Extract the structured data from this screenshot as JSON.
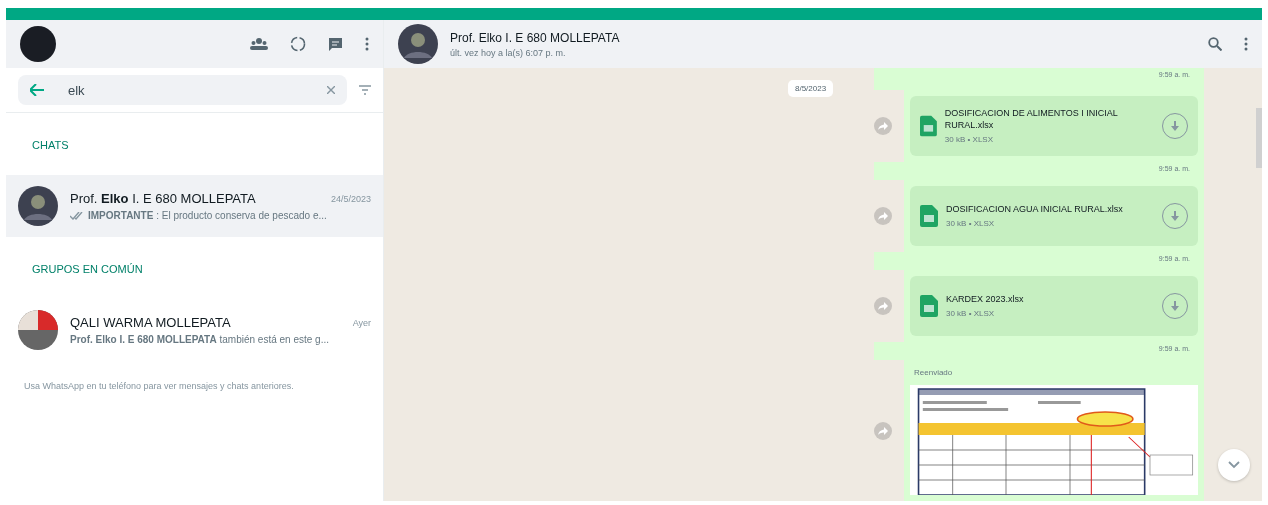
{
  "sidebar": {
    "search": {
      "value": "elk"
    },
    "sections": [
      {
        "title": "CHATS",
        "items": [
          {
            "name": "Prof. **Elko** I. E 680 MOLLEPATA",
            "time": "24/5/2023",
            "preview": "**IMPORTANTE** : El producto conserva de pescado e...",
            "ticks": true,
            "selected": true
          }
        ]
      },
      {
        "title": "GRUPOS EN COMÚN",
        "items": [
          {
            "name": "QALI WARMA MOLLEPATA",
            "time": "Ayer",
            "preview": "**Prof. Elko I. E 680 MOLLEPATA** también está en este g...",
            "selected": false
          }
        ]
      }
    ],
    "note": "Usa WhatsApp en tu teléfono para ver mensajes y chats anteriores."
  },
  "chat": {
    "title": "Prof. Elko I. E 680 MOLLEPATA",
    "subtitle": "últ. vez hoy a la(s) 6:07 p. m.",
    "date_chip": "8/5/2023",
    "top_time": "9:59 a. m.",
    "messages": [
      {
        "kind": "file",
        "name": "DOSIFICACION DE ALIMENTOS I INICIAL RURAL.xlsx",
        "meta": "30 kB • XLSX",
        "time": "9:59 a. m."
      },
      {
        "kind": "file",
        "name": "DOSIFICACION AGUA INICIAL RURAL.xlsx",
        "meta": "30 kB • XLSX",
        "time": "9:59 a. m."
      },
      {
        "kind": "file",
        "name": "KARDEX 2023.xlsx",
        "meta": "30 kB • XLSX",
        "time": "9:59 a. m."
      },
      {
        "label": "Reenviado"
      }
    ]
  }
}
